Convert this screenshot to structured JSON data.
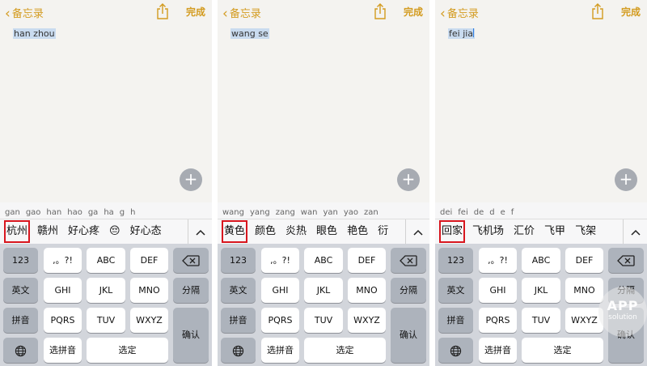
{
  "accent_color": "#d39b1f",
  "highlight_color": "#d8161e",
  "panels": [
    {
      "nav": {
        "back_label": "备忘录",
        "done_label": "完成"
      },
      "note_text": "han zhou",
      "pinyin_options": [
        "gan",
        "gao",
        "han",
        "hao",
        "ga",
        "ha",
        "g",
        "h"
      ],
      "candidates": [
        "杭州",
        "赣州",
        "好心疼",
        "😔",
        "好心态"
      ],
      "highlighted_candidate": "杭州",
      "keys": {
        "num": "123",
        "punct": ",。?!",
        "abc": "ABC",
        "def": "DEF",
        "english": "英文",
        "ghi": "GHI",
        "jkl": "JKL",
        "mno": "MNO",
        "separator": "分隔",
        "pinyin": "拼音",
        "pqrs": "PQRS",
        "tuv": "TUV",
        "wxyz": "WXYZ",
        "select_pinyin": "选拼音",
        "select": "选定",
        "confirm": "确认"
      }
    },
    {
      "nav": {
        "back_label": "备忘录",
        "done_label": "完成"
      },
      "note_text": "wang se",
      "pinyin_options": [
        "wang",
        "yang",
        "zang",
        "wan",
        "yan",
        "yao",
        "zan"
      ],
      "candidates": [
        "黄色",
        "颜色",
        "炎热",
        "眼色",
        "艳色",
        "衍"
      ],
      "highlighted_candidate": "黄色",
      "keys": {
        "num": "123",
        "punct": ",。?!",
        "abc": "ABC",
        "def": "DEF",
        "english": "英文",
        "ghi": "GHI",
        "jkl": "JKL",
        "mno": "MNO",
        "separator": "分隔",
        "pinyin": "拼音",
        "pqrs": "PQRS",
        "tuv": "TUV",
        "wxyz": "WXYZ",
        "select_pinyin": "选拼音",
        "select": "选定",
        "confirm": "确认"
      }
    },
    {
      "nav": {
        "back_label": "备忘录",
        "done_label": "完成"
      },
      "note_text": "fei jia",
      "pinyin_options": [
        "dei",
        "fei",
        "de",
        "d",
        "e",
        "f"
      ],
      "candidates": [
        "回家",
        "飞机场",
        "汇价",
        "飞甲",
        "飞架"
      ],
      "highlighted_candidate": "回家",
      "keys": {
        "num": "123",
        "punct": ",。?!",
        "abc": "ABC",
        "def": "DEF",
        "english": "英文",
        "ghi": "GHI",
        "jkl": "JKL",
        "mno": "MNO",
        "separator": "分隔",
        "pinyin": "拼音",
        "pqrs": "PQRS",
        "tuv": "TUV",
        "wxyz": "WXYZ",
        "select_pinyin": "选拼音",
        "select": "选定",
        "confirm": "确认"
      }
    }
  ],
  "icons": [
    "chevron-left-icon",
    "share-icon",
    "plus-icon",
    "chevron-up-icon",
    "backspace-icon",
    "globe-icon"
  ],
  "watermark": {
    "line1": "APP",
    "line2": "solution"
  }
}
